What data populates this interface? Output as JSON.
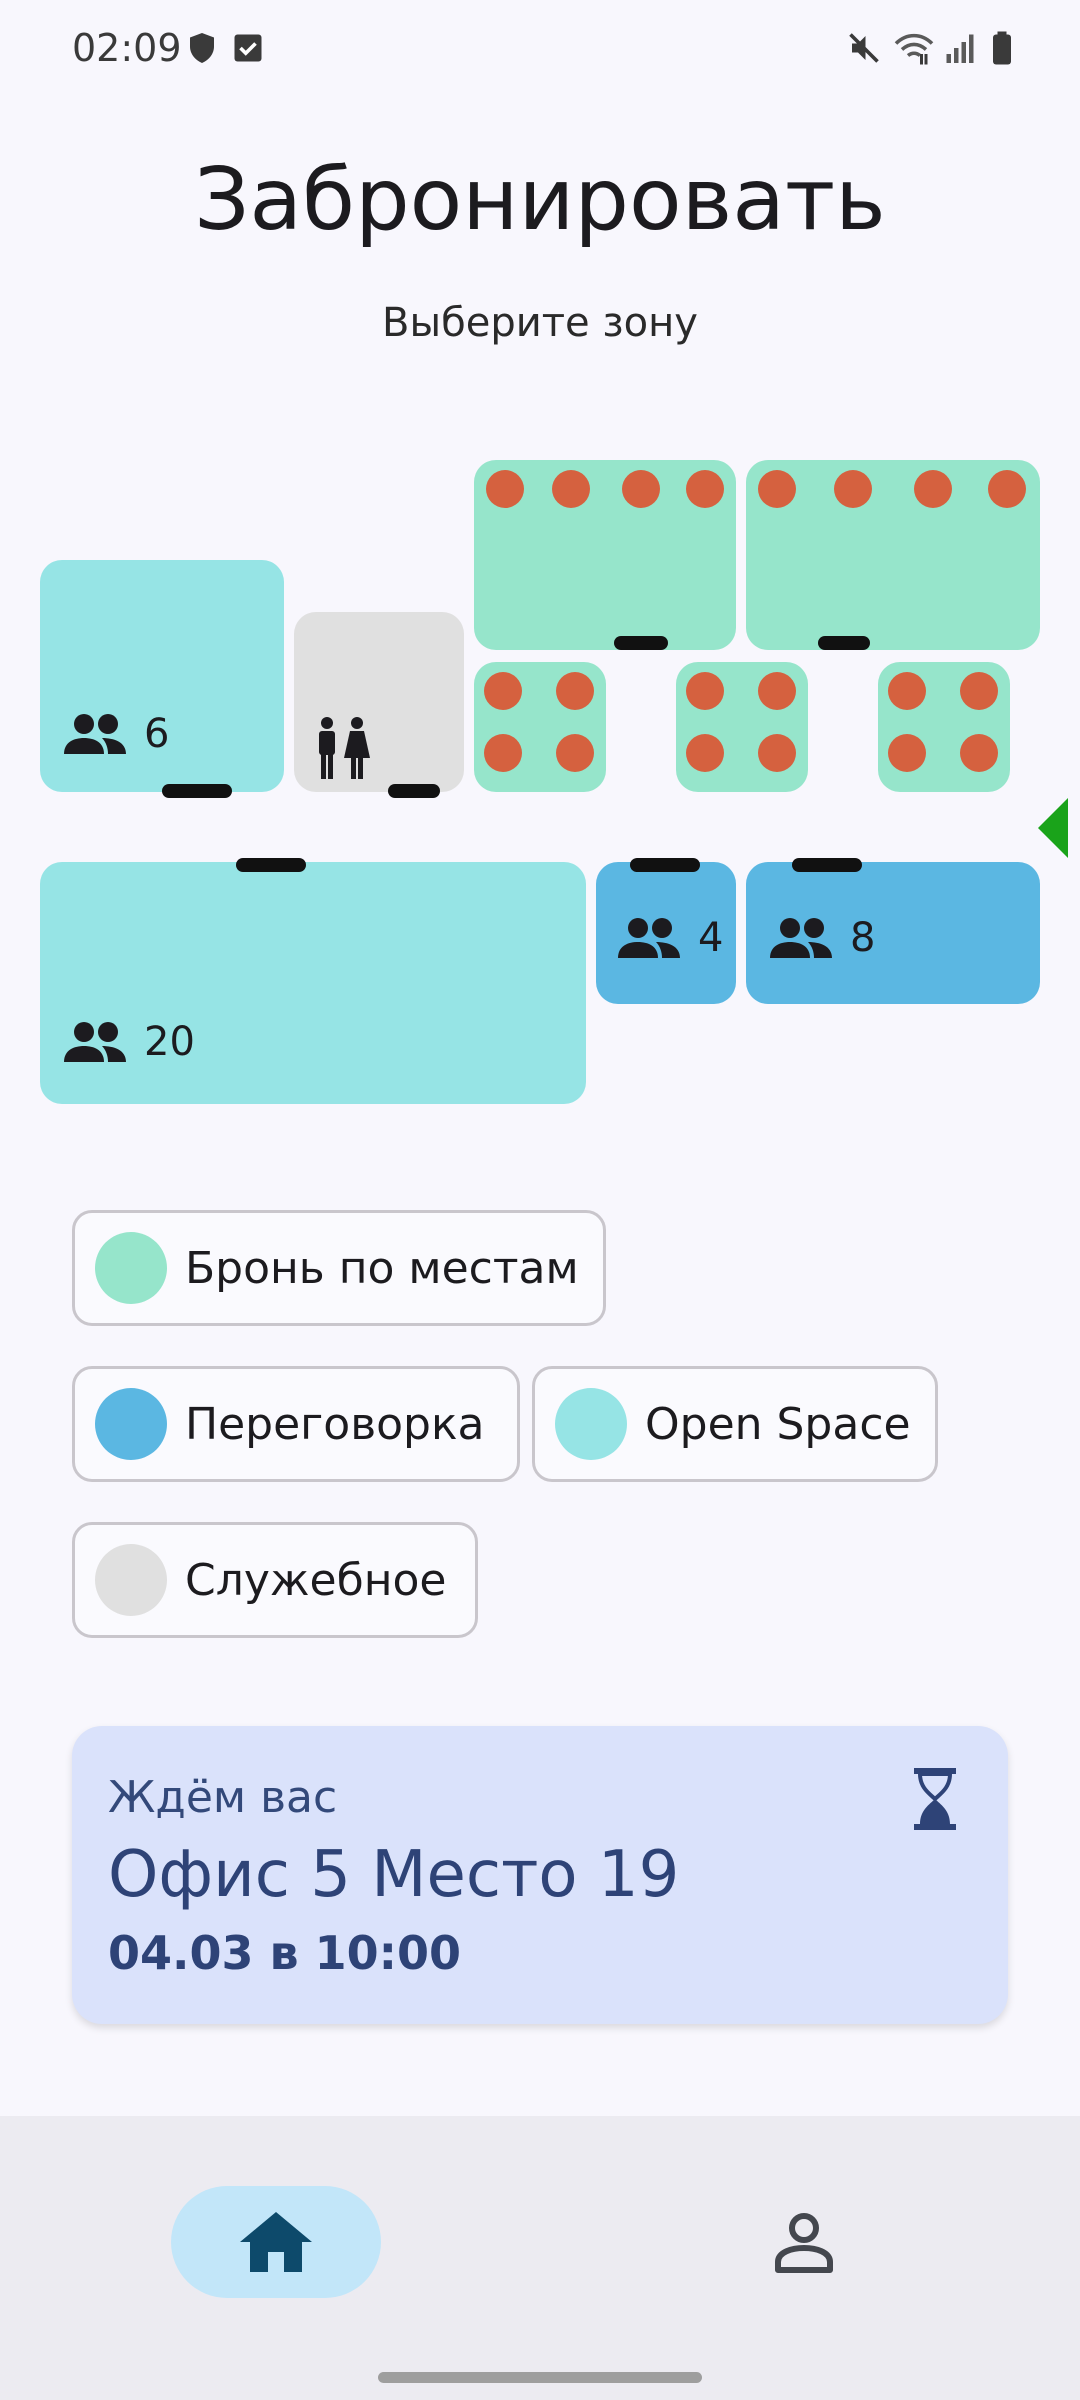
{
  "status_bar": {
    "time": "02:09",
    "left_icons": [
      "shield-icon",
      "checkbox-icon"
    ],
    "right_icons": [
      "mute-icon",
      "wifi-icon",
      "signal-icon",
      "battery-icon"
    ]
  },
  "header": {
    "title": "Забронировать",
    "subtitle": "Выберите зону"
  },
  "map": {
    "zones": {
      "open_space_small": {
        "capacity": "6",
        "icon": "people-icon"
      },
      "service": {
        "icon": "restroom-icon"
      },
      "open_space_large": {
        "capacity": "20",
        "icon": "people-icon"
      },
      "meeting_small": {
        "capacity": "4",
        "icon": "people-icon"
      },
      "meeting_large": {
        "capacity": "8",
        "icon": "people-icon"
      }
    },
    "colors": {
      "seat_booking": "#96e5cb",
      "meeting": "#5bb7e2",
      "open_space": "#96e4e5",
      "service": "#e0e0e0",
      "seat": "#d5613f",
      "door": "#111111",
      "scroll_arrow": "#1aa31a"
    }
  },
  "legend": {
    "items": [
      {
        "label": "Бронь по местам",
        "color": "#96e5cb"
      },
      {
        "label": "Переговорка",
        "color": "#5bb7e2"
      },
      {
        "label": "Open Space",
        "color": "#96e4e5"
      },
      {
        "label": "Служебное",
        "color": "#e0e0e0"
      }
    ]
  },
  "booking_card": {
    "label": "Ждём вас",
    "place": "Офис 5 Место 19",
    "datetime": "04.03 в 10:00",
    "icon": "hourglass-icon",
    "background": "#dae2fb"
  },
  "bottom_nav": {
    "items": [
      {
        "icon": "home-icon",
        "active": true
      },
      {
        "icon": "profile-icon",
        "active": false
      }
    ],
    "active_color": "#c2e6f9"
  }
}
